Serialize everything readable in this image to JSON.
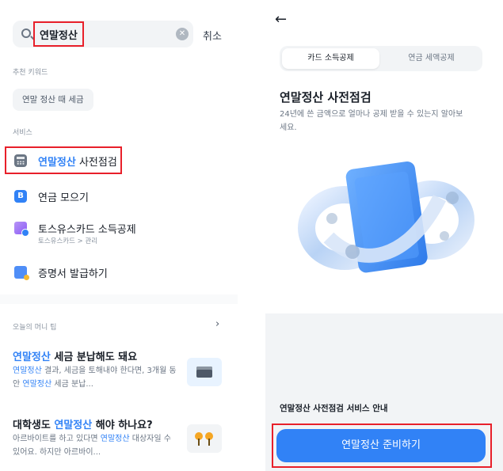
{
  "search": {
    "query": "연말정산",
    "cancel_label": "취소"
  },
  "recommended": {
    "heading": "추천 키워드",
    "chips": [
      "연말 정산 때 세금"
    ]
  },
  "services": {
    "heading": "서비스",
    "items": [
      {
        "keyword": "연말정산",
        "rest": " 사전점검",
        "icon": "calculator-icon"
      },
      {
        "label": "연금 모으기",
        "icon": "b-badge-icon"
      },
      {
        "label": "토스유스카드 소득공제",
        "sub": "토스유스카드 > 관리",
        "icon": "card-icon"
      },
      {
        "label": "증명서 발급하기",
        "icon": "document-icon"
      }
    ]
  },
  "tips": {
    "heading": "오늘의 머니 팁",
    "articles": [
      {
        "title_keyword": "연말정산",
        "title_rest": " 세금 분납해도 돼요",
        "body_kw1": "연말정산",
        "body_mid": " 결과, 세금을 토해내야 한다면, 3개월 동안 ",
        "body_kw2": "연말정산",
        "body_end": " 세금 분납...",
        "thumb_icon": "cash-register-icon"
      },
      {
        "title_pre": "대학생도 ",
        "title_keyword": "연말정산",
        "title_rest": " 해야 하나요?",
        "body_pre": "아르바이트를 하고 있다면 ",
        "body_kw": "연말정산",
        "body_end": " 대상자일 수 있어요. 하지만 아르바이...",
        "thumb_icon": "pins-icon"
      }
    ]
  },
  "detail": {
    "tabs": [
      "카드 소득공제",
      "연금 세액공제"
    ],
    "active_tab": 0,
    "title": "연말정산 사전점검",
    "description": "24년에 쓴 금액으로 얼마나 공제 받을 수 있는지 알아보세요.",
    "guide_label": "연말정산 사전점검 서비스 안내",
    "cta_label": "연말정산 준비하기"
  },
  "colors": {
    "accent": "#3182f6",
    "highlight_box": "#e8202a"
  }
}
